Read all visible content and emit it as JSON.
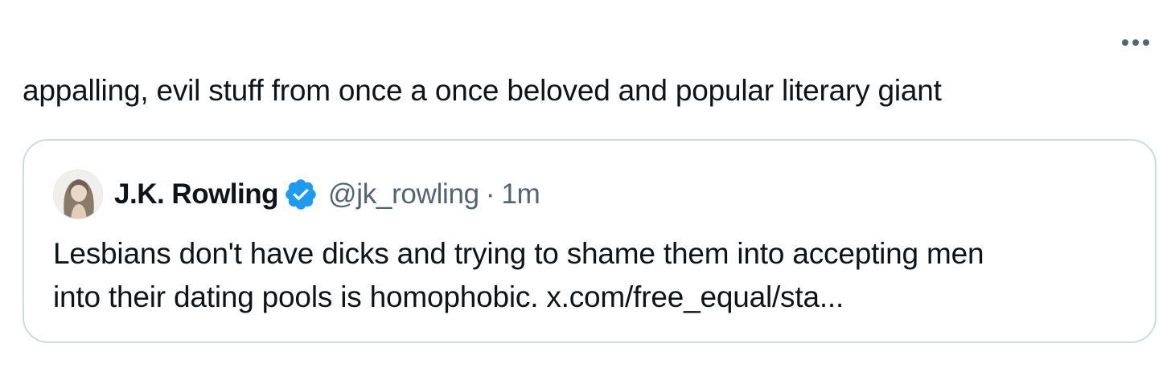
{
  "tweet": {
    "text": "appalling, evil stuff from once a once beloved and popular literary giant",
    "more_icon": "more-horizontal-icon"
  },
  "quote": {
    "author_name": "J.K. Rowling",
    "verified_icon": "verified-badge-icon",
    "handle": "@jk_rowling",
    "separator": "·",
    "timestamp": "1m",
    "text_line1": "Lesbians don't have dicks and trying to shame them into accepting men",
    "text_line2": "into their dating pools is homophobic. x.com/free_equal/sta..."
  },
  "colors": {
    "text_primary": "#0f1419",
    "text_secondary": "#536471",
    "border": "#cfd9de",
    "verified_blue": "#1d9bf0"
  }
}
